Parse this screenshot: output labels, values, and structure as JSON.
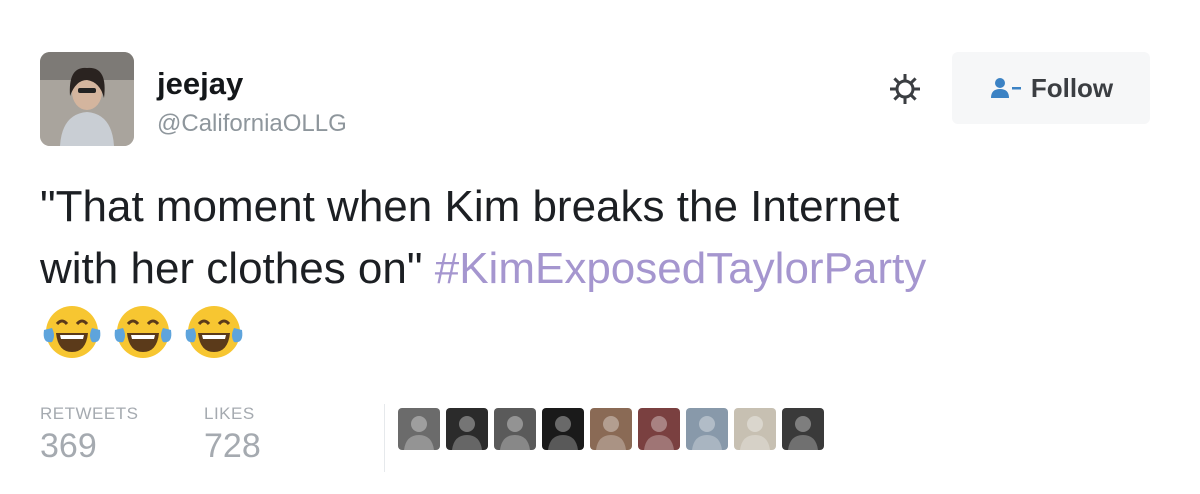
{
  "user": {
    "name": "jeejay",
    "handle": "@CaliforniaOLLG",
    "avatar_icon": "user-avatar-photo"
  },
  "actions": {
    "settings_icon": "gear-icon",
    "follow_icon": "person-plus-icon",
    "follow_label": "Follow"
  },
  "tweet": {
    "text_line1": "\"That moment when Kim breaks the Internet",
    "text_line2": "with her clothes on\"",
    "hashtag": "#KimExposedTaylorParty",
    "emojis": [
      "face-with-tears-of-joy",
      "face-with-tears-of-joy",
      "face-with-tears-of-joy"
    ],
    "hashtag_color": "#a596cf"
  },
  "stats": {
    "retweets_label": "RETWEETS",
    "retweets_value": "369",
    "likes_label": "LIKES",
    "likes_value": "728"
  },
  "likers": [
    {
      "icon": "liker-avatar",
      "color": "#6b6b6b"
    },
    {
      "icon": "liker-avatar",
      "color": "#2b2b2b"
    },
    {
      "icon": "liker-avatar",
      "color": "#5a5a5a"
    },
    {
      "icon": "liker-avatar",
      "color": "#1a1a1a"
    },
    {
      "icon": "liker-avatar",
      "color": "#8a6a55"
    },
    {
      "icon": "liker-avatar",
      "color": "#7a4040"
    },
    {
      "icon": "liker-avatar",
      "color": "#8899aa"
    },
    {
      "icon": "liker-avatar",
      "color": "#c7c0b2"
    },
    {
      "icon": "liker-avatar",
      "color": "#3a3a3a"
    }
  ]
}
